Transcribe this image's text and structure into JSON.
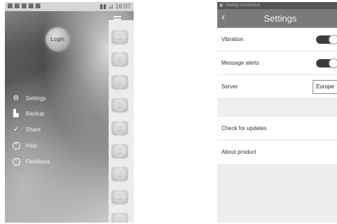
{
  "left_phone": {
    "status_bar": {
      "time": "16:07"
    },
    "login_label": "Login",
    "menu": [
      {
        "icon": "gear-icon",
        "label": "Settings"
      },
      {
        "icon": "backup-icon",
        "label": "Backup"
      },
      {
        "icon": "share-icon",
        "label": "Share"
      },
      {
        "icon": "help-icon",
        "label": "Help"
      },
      {
        "icon": "feedback-icon",
        "label": "Feedback"
      }
    ],
    "device_tile_count": 9
  },
  "right_phone": {
    "status_bar": {
      "notice": "Saving screenshot"
    },
    "title": "Settings",
    "rows": {
      "vibration": {
        "label": "Vibration",
        "on": true
      },
      "message_alerts": {
        "label": "Message alerts",
        "on": true
      },
      "server": {
        "label": "Server",
        "value": "Europe"
      },
      "check_updates": {
        "label": "Check for updates"
      },
      "about": {
        "label": "About product"
      }
    }
  }
}
